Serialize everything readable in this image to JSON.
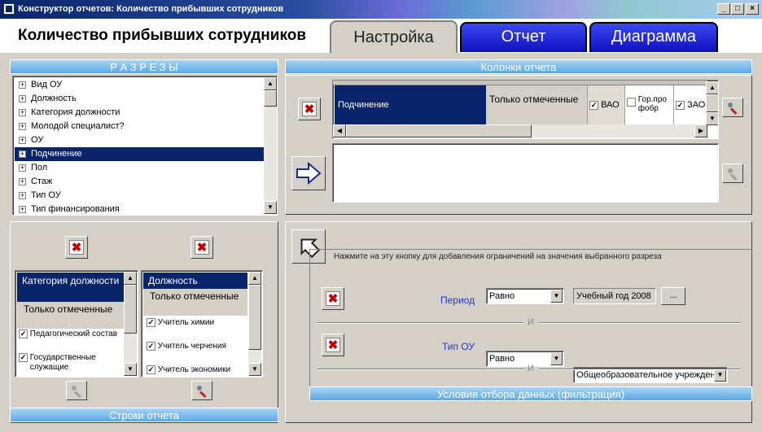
{
  "window": {
    "title": "Конструктор отчетов: Количество прибывших сотрудников",
    "minimize": "_",
    "maximize": "□",
    "close": "×"
  },
  "page_title": "Количество прибывших сотрудников",
  "tabs": [
    {
      "label": "Настройка"
    },
    {
      "label": "Отчет"
    },
    {
      "label": "Диаграмма"
    }
  ],
  "razrezy": {
    "header": "Р А З Р Е З Ы",
    "items": [
      {
        "label": "Вид ОУ"
      },
      {
        "label": "Должность"
      },
      {
        "label": "Категория должности"
      },
      {
        "label": "Молодой специалист?"
      },
      {
        "label": "ОУ"
      },
      {
        "label": "Подчинение"
      },
      {
        "label": "Пол"
      },
      {
        "label": "Стаж"
      },
      {
        "label": "Тип ОУ"
      },
      {
        "label": "Тип финансирования"
      }
    ]
  },
  "columns": {
    "header": "Колонки отчета",
    "row": {
      "name": "Подчинение",
      "mode": "Только отмеченные",
      "options": [
        {
          "label": "ВАО",
          "checked": true
        },
        {
          "label": "Гор.про фобр",
          "checked": false
        },
        {
          "label": "ЗАО",
          "checked": true
        }
      ]
    }
  },
  "rows_panel": {
    "footer": "Строки отчета",
    "list1": {
      "title": "Категория должности",
      "mode": "Только отмеченные",
      "items": [
        {
          "label": "Педагогический состав",
          "checked": true
        },
        {
          "label": "Государственные служащие",
          "checked": true
        }
      ]
    },
    "list2": {
      "title": "Должность",
      "mode": "Только отмеченные",
      "items": [
        {
          "label": "Учитель химии",
          "checked": true
        },
        {
          "label": "Учитель черчения",
          "checked": true
        },
        {
          "label": "Учитель экономики",
          "checked": true
        }
      ]
    }
  },
  "filter": {
    "hint": "Нажмите на эту кнопку для добавления ограничений на значения выбранного разреза",
    "footer": "Условия отбора данных (фильтрация)",
    "separator": "И",
    "conditions": [
      {
        "label": "Период",
        "operator": "Равно",
        "value": "Учебный год 2008",
        "more": "..."
      },
      {
        "label": "Тип ОУ",
        "operator": "Равно",
        "value": "Общеобразовательное учрежден"
      }
    ]
  },
  "icons": {
    "delete": "delete-x-icon",
    "settings": "wrench-icon",
    "add_column": "arrow-right-icon",
    "add_filter": "home-arrow-icon"
  }
}
